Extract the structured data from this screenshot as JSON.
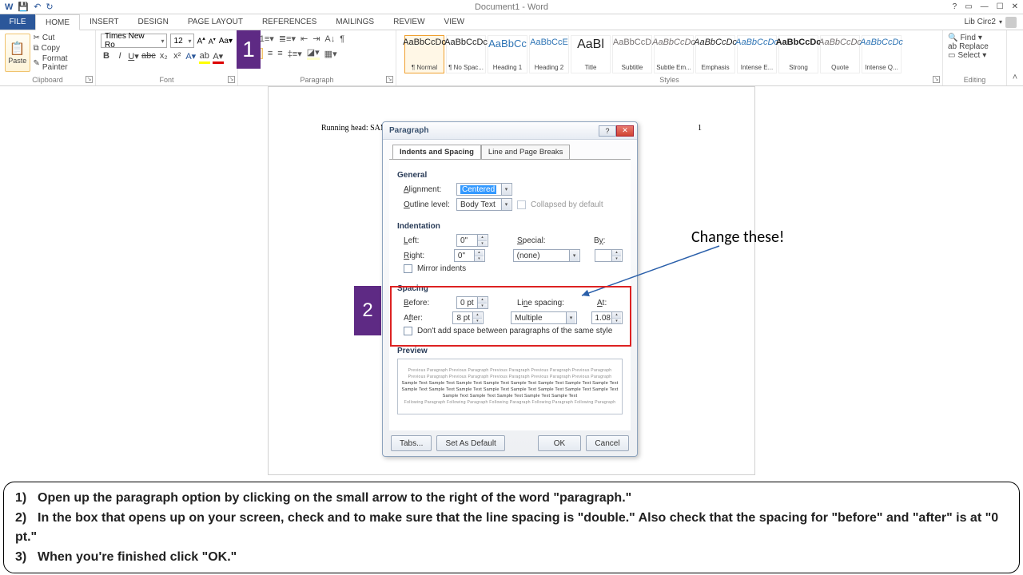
{
  "titlebar": {
    "center": "Document1 - Word",
    "user": "Lib Circ2"
  },
  "tabs": {
    "file": "FILE",
    "home": "HOME",
    "insert": "INSERT",
    "design": "DESIGN",
    "pagelayout": "PAGE LAYOUT",
    "references": "REFERENCES",
    "mailings": "MAILINGS",
    "review": "REVIEW",
    "view": "VIEW"
  },
  "clipboard": {
    "paste": "Paste",
    "cut": "Cut",
    "copy": "Copy",
    "formatpainter": "Format Painter",
    "label": "Clipboard"
  },
  "font": {
    "name": "Times New Ro",
    "size": "12",
    "label": "Font"
  },
  "paragraph": {
    "label": "Paragraph"
  },
  "styles": {
    "label": "Styles",
    "items": [
      {
        "sample": "AaBbCcDc",
        "name": "¶ Normal"
      },
      {
        "sample": "AaBbCcDc",
        "name": "¶ No Spac..."
      },
      {
        "sample": "AaBbCc",
        "name": "Heading 1"
      },
      {
        "sample": "AaBbCcE",
        "name": "Heading 2"
      },
      {
        "sample": "AaBl",
        "name": "Title"
      },
      {
        "sample": "AaBbCcD",
        "name": "Subtitle"
      },
      {
        "sample": "AaBbCcDc",
        "name": "Subtle Em..."
      },
      {
        "sample": "AaBbCcDc",
        "name": "Emphasis"
      },
      {
        "sample": "AaBbCcDc",
        "name": "Intense E..."
      },
      {
        "sample": "AaBbCcDc",
        "name": "Strong"
      },
      {
        "sample": "AaBbCcDc",
        "name": "Quote"
      },
      {
        "sample": "AaBbCcDc",
        "name": "Intense Q..."
      }
    ]
  },
  "editing": {
    "find": "Find",
    "replace": "Replace",
    "select": "Select",
    "label": "Editing"
  },
  "page": {
    "header": "Running head: SAMPLE APA PAPER",
    "num": "1"
  },
  "dialog": {
    "title": "Paragraph",
    "tab1": "Indents and Spacing",
    "tab2": "Line and Page Breaks",
    "general": "General",
    "alignment_l": "Alignment:",
    "alignment_v": "Centered",
    "outline_l": "Outline level:",
    "outline_v": "Body Text",
    "collapsed": "Collapsed by default",
    "indentation": "Indentation",
    "left_l": "Left:",
    "left_v": "0\"",
    "right_l": "Right:",
    "right_v": "0\"",
    "special_l": "Special:",
    "special_v": "(none)",
    "by_l": "By:",
    "mirror": "Mirror indents",
    "spacing": "Spacing",
    "before_l": "Before:",
    "before_v": "0 pt",
    "after_l": "After:",
    "after_v": "8 pt",
    "linespacing_l": "Line spacing:",
    "linespacing_v": "Multiple",
    "at_l": "At:",
    "at_v": "1.08",
    "dontadd": "Don't add space between paragraphs of the same style",
    "preview": "Preview",
    "tabs_btn": "Tabs...",
    "default_btn": "Set As Default",
    "ok": "OK",
    "cancel": "Cancel"
  },
  "anno": {
    "change": "Change these!"
  },
  "callouts": {
    "c1": "1",
    "c2": "2"
  },
  "instructions": {
    "l1n": "1)",
    "l1": "Open up the paragraph  option by clicking on the small arrow to the right of the word \"paragraph.\"",
    "l2n": "2)",
    "l2": "In the box that opens up on your screen, check and to make sure that the line spacing is \"double.\"  Also check that the spacing for \"before\" and \"after\" is at \"0 pt.\"",
    "l3n": "3)",
    "l3": "When you're finished click \"OK.\""
  }
}
